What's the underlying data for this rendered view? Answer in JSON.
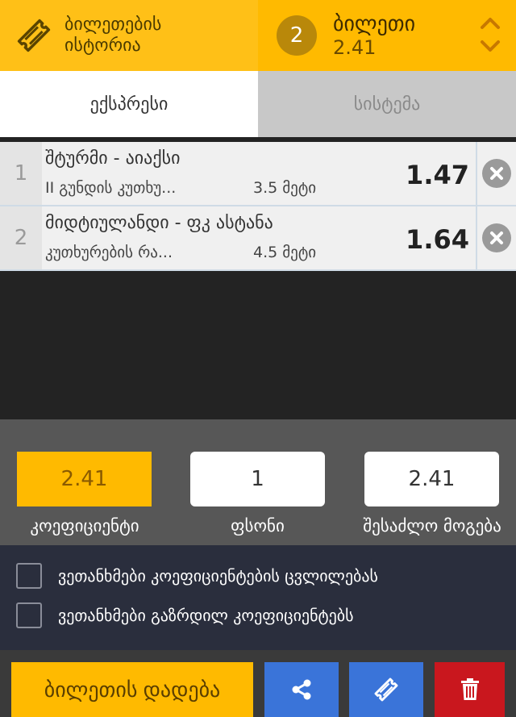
{
  "header": {
    "history_label": "ბილეთების ისტორია",
    "ticket_count": "2",
    "betslip_title": "ბილეთი",
    "betslip_total": "2.41"
  },
  "tabs": [
    {
      "label": "ექსპრესი",
      "active": true
    },
    {
      "label": "სისტემა",
      "active": false
    }
  ],
  "events": [
    {
      "num": "1",
      "title": "შტურმი - აიაქსი",
      "market": "II გუნდის კუთხუ...",
      "outcome": "3.5 მეტი",
      "odds": "1.47"
    },
    {
      "num": "2",
      "title": "მიდტიულანდი - ფკ ასტანა",
      "market": "კუთხურების რა...",
      "outcome": "4.5 მეტი",
      "odds": "1.64"
    }
  ],
  "summary": {
    "odds_value": "2.41",
    "odds_label": "კოეფიციენტი",
    "stake_value": "1",
    "stake_label": "ფსონი",
    "win_value": "2.41",
    "win_label": "შესაძლო მოგება"
  },
  "options": {
    "accept_changes": "ვეთანხმები კოეფიციენტების ცვლილებას",
    "accept_boosted": "ვეთანხმები გაზრდილ კოეფიციენტებს"
  },
  "actions": {
    "place_label": "ბილეთის დადება"
  },
  "colors": {
    "accent_yellow": "#ffba00",
    "action_blue": "#3a74d9",
    "delete_red": "#c9171e"
  }
}
